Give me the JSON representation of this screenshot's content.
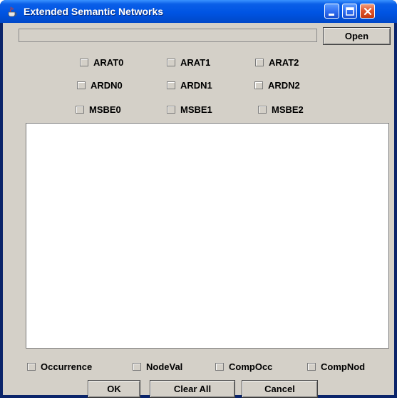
{
  "window": {
    "title": "Extended Semantic Networks",
    "icon": "java-cup-icon",
    "controls": [
      "minimize-icon",
      "maximize-icon",
      "close-icon"
    ],
    "colors": {
      "titlebar": "#0054e3",
      "client": "#d4d0c8",
      "close": "#e0562e"
    }
  },
  "file": {
    "path_value": "",
    "open_label": "Open"
  },
  "checkboxes": {
    "row1": [
      {
        "label": "ARAT0",
        "checked": false
      },
      {
        "label": "ARAT1",
        "checked": false
      },
      {
        "label": "ARAT2",
        "checked": false
      }
    ],
    "row2": [
      {
        "label": "ARDN0",
        "checked": false
      },
      {
        "label": "ARDN1",
        "checked": false
      },
      {
        "label": "ARDN2",
        "checked": false
      }
    ],
    "row3": [
      {
        "label": "MSBE0",
        "checked": false
      },
      {
        "label": "MSBE1",
        "checked": false
      },
      {
        "label": "MSBE2",
        "checked": false
      }
    ]
  },
  "output_text": "",
  "options": [
    {
      "label": "Occurrence",
      "checked": false
    },
    {
      "label": "NodeVal",
      "checked": false
    },
    {
      "label": "CompOcc",
      "checked": false
    },
    {
      "label": "CompNod",
      "checked": false
    }
  ],
  "actions": {
    "ok_label": "OK",
    "clear_label": "Clear All",
    "cancel_label": "Cancel"
  }
}
